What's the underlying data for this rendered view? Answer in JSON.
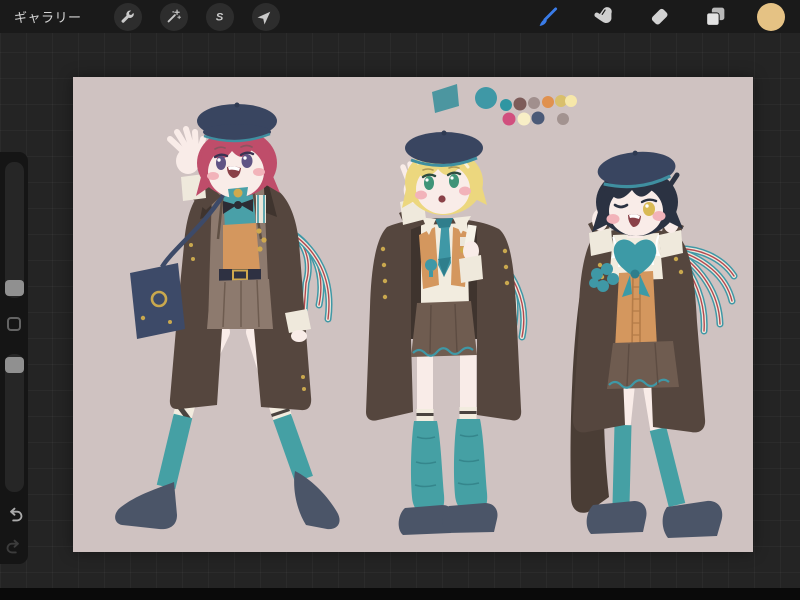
{
  "top_bar": {
    "gallery_label": "ギャラリー",
    "left_tools": [
      {
        "label": "Actions",
        "icon": "wrench-icon"
      },
      {
        "label": "Adjustments",
        "icon": "magic-wand-icon"
      },
      {
        "label": "Selection",
        "icon": "selection-s-icon"
      },
      {
        "label": "Transform",
        "icon": "transform-arrow-icon"
      }
    ],
    "selection_letter": "S",
    "right_tools": [
      {
        "label": "Paint",
        "icon": "brush-icon",
        "active": true
      },
      {
        "label": "Smudge",
        "icon": "smudge-finger-icon",
        "active": false
      },
      {
        "label": "Erase",
        "icon": "eraser-icon",
        "active": false
      },
      {
        "label": "Layers",
        "icon": "layers-icon",
        "active": false
      }
    ],
    "active_tool_color": "#3a7ce8",
    "selected_color": "#e5c284"
  },
  "sidebar": {
    "sliders": [
      {
        "name": "brush-size",
        "handle_position": "bottom"
      },
      {
        "name": "opacity",
        "handle_position": "top"
      }
    ],
    "has_modify_button": true,
    "undo_enabled": true,
    "redo_enabled": false
  },
  "canvas": {
    "background": "#cfc2c1",
    "palette_swatches": {
      "blob": "#4c96a0",
      "large": "#3f98a6",
      "row1": [
        "#2f96a2",
        "#7d5b59",
        "#a18f8d",
        "#e0914f",
        "#d9bf6b",
        "#f6e7a9"
      ],
      "row2": [
        "#d14f7e",
        "#f8eec6",
        "#4b5a78",
        "#a39390"
      ]
    },
    "artwork": {
      "description": "Character sheet: three chibi boys in matching navy berets, dark brown military coats, orange vests, brown shorts and teal socks",
      "characters": [
        {
          "position": "left",
          "hair_color": "#bf4d6a",
          "eye_color": "#5f5384",
          "pose": "waving, carrying navy shoulder bag"
        },
        {
          "position": "center",
          "hair_color": "#ecd77e",
          "eye_color": "#3f9478",
          "pose": "saluting, coat draped over shoulders"
        },
        {
          "position": "right",
          "hair_color": "#2b3242",
          "eye_color": "#d9ba55",
          "pose": "winking, pointing at cheeks, teal awareness ribbon"
        }
      ],
      "shared_colors": {
        "beret": "#394560",
        "coat": "#55463e",
        "teal": "#45a0a4",
        "vest_orange": "#d4975e",
        "shorts": "#6f5c50",
        "skin": "#f9ece8",
        "shoes": "#4b5568",
        "ribbon_stripe_red": "#b5484f",
        "gold": "#d0a94e"
      }
    }
  }
}
